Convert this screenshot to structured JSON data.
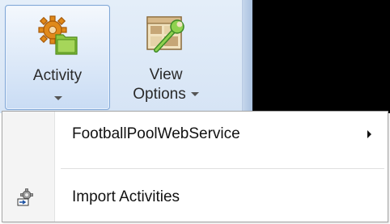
{
  "ribbon": {
    "buttons": [
      {
        "label": "Activity",
        "icon": "activity-gear-folder-icon",
        "has_dropdown": true,
        "selected": true
      },
      {
        "label_line1": "View",
        "label_line2": "Options",
        "icon": "view-options-wrench-icon",
        "has_dropdown": true
      }
    ]
  },
  "menu": {
    "items": [
      {
        "label": "FootballPoolWebService",
        "has_submenu": true
      },
      {
        "label": "Import Activities",
        "icon": "import-activities-icon"
      }
    ]
  },
  "colors": {
    "ribbon_bg": "#dde8f5",
    "selected_border": "#7fa6d6",
    "menu_gutter": "#f4f4f4"
  }
}
